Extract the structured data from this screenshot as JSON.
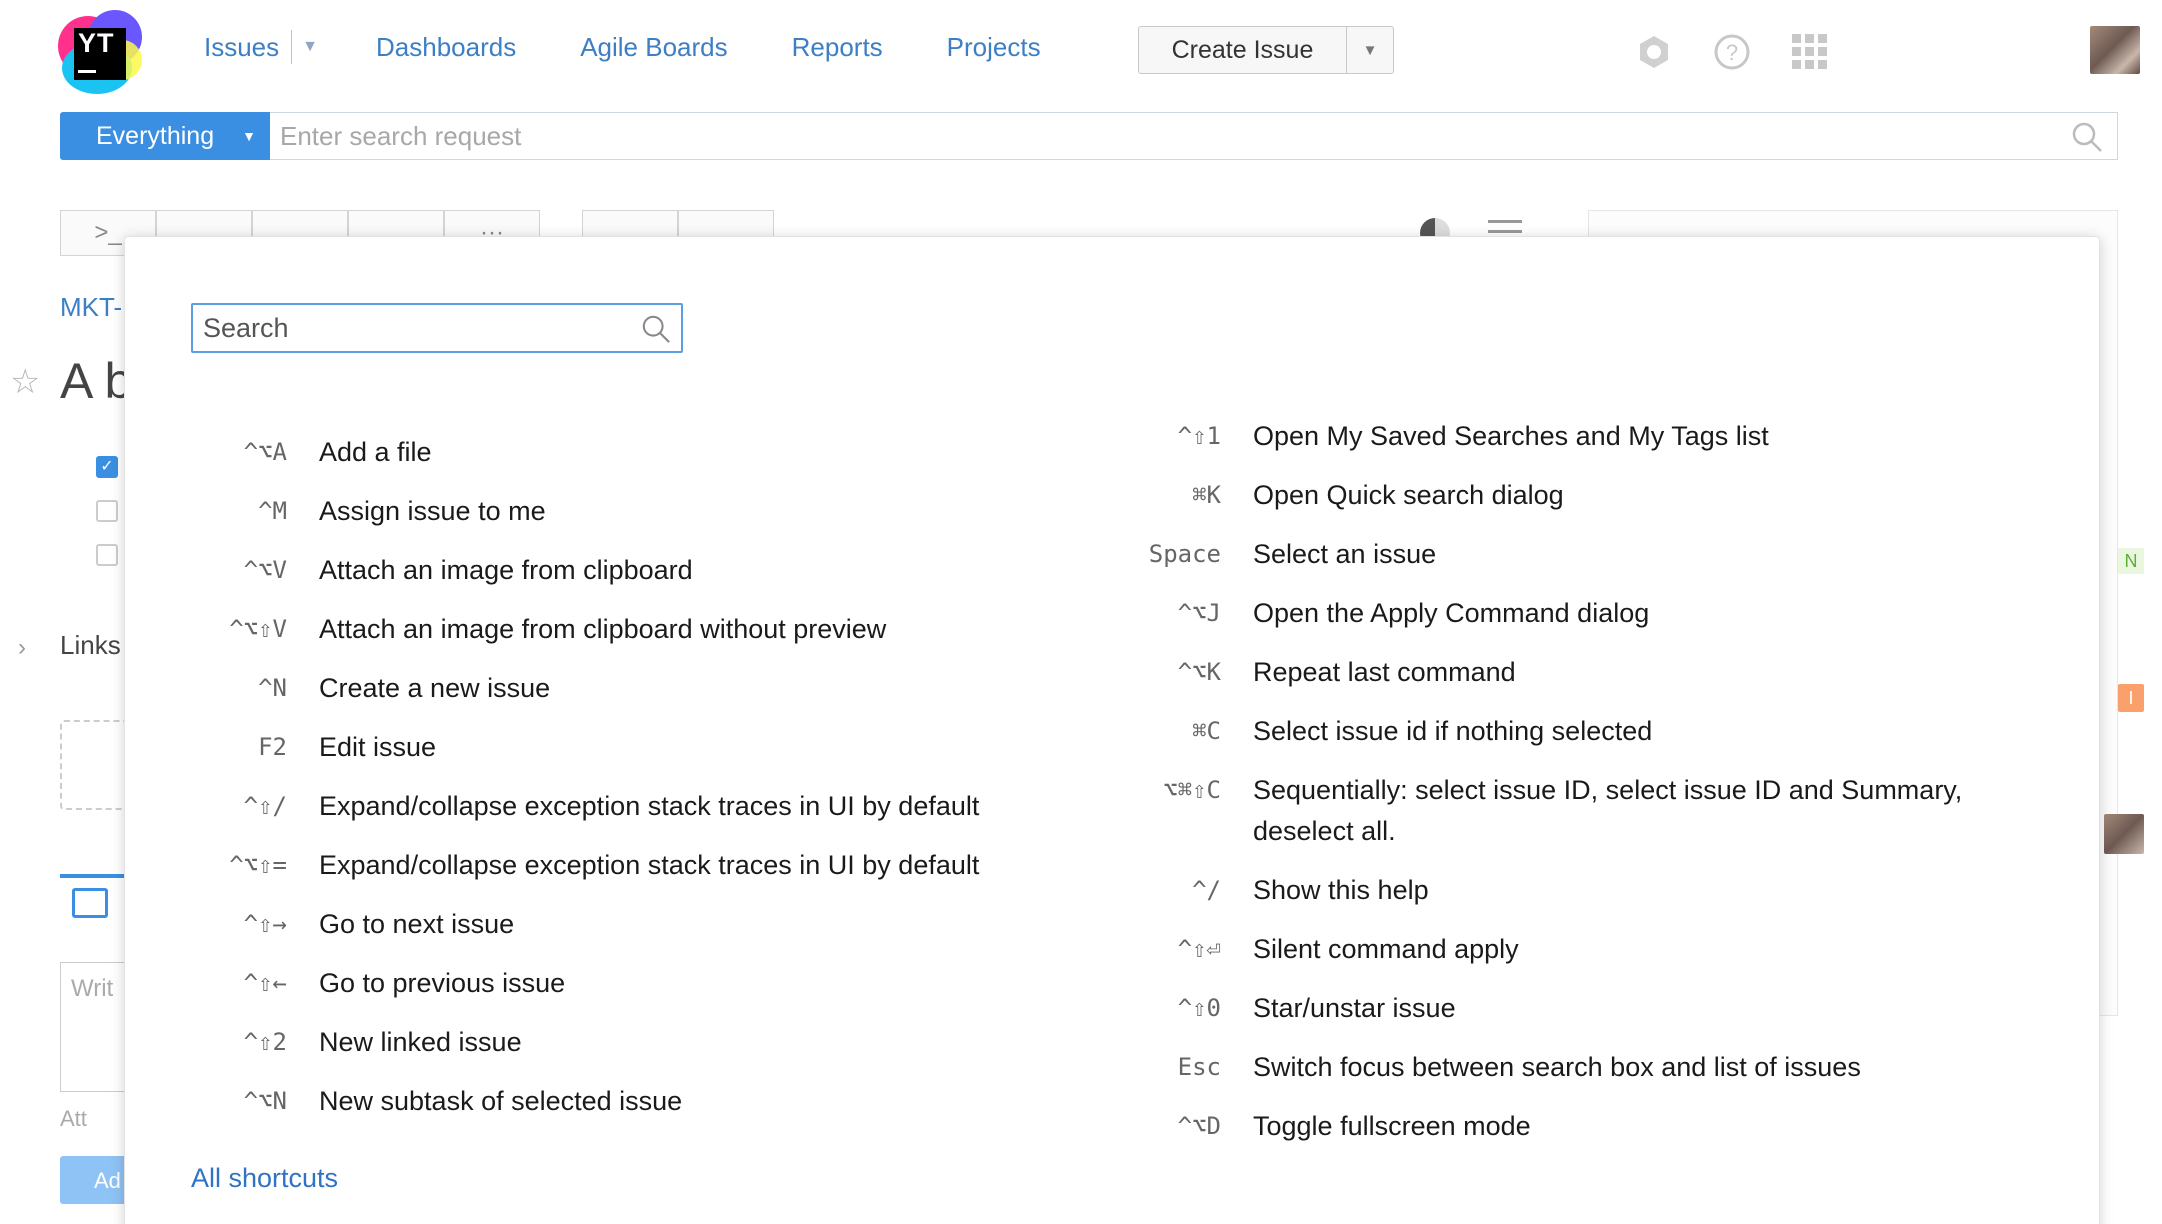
{
  "app": {
    "logo_text": "YT"
  },
  "nav": {
    "issues": "Issues",
    "dashboards": "Dashboards",
    "agile_boards": "Agile Boards",
    "reports": "Reports",
    "projects": "Projects",
    "create_issue": "Create Issue"
  },
  "header_icons": [
    "hub-icon",
    "help-icon",
    "apps-grid-icon"
  ],
  "search": {
    "context": "Everything",
    "placeholder": "Enter search request"
  },
  "background": {
    "issue_id": "MKT-",
    "issue_title": "A b",
    "links_label": "Links",
    "write_placeholder": "Writ",
    "attach_label": "Att",
    "add_button": "Ad",
    "tag_n": "N",
    "tag_i": "I"
  },
  "shortcuts_modal": {
    "search_placeholder": "Search",
    "left_column": [
      {
        "keys": "^⌥A",
        "desc": "Add a file"
      },
      {
        "keys": "^M",
        "desc": "Assign issue to me"
      },
      {
        "keys": "^⌥V",
        "desc": "Attach an image from clipboard"
      },
      {
        "keys": "^⌥⇧V",
        "desc": "Attach an image from clipboard without preview"
      },
      {
        "keys": "^N",
        "desc": "Create a new issue"
      },
      {
        "keys": "F2",
        "desc": "Edit issue"
      },
      {
        "keys": "^⇧/",
        "desc": "Expand/collapse exception stack traces in UI by default"
      },
      {
        "keys": "^⌥⇧=",
        "desc": "Expand/collapse exception stack traces in UI by default"
      },
      {
        "keys": "^⇧→",
        "desc": "Go to next issue"
      },
      {
        "keys": "^⇧←",
        "desc": "Go to previous issue"
      },
      {
        "keys": "^⇧2",
        "desc": "New linked issue"
      },
      {
        "keys": "^⌥N",
        "desc": "New subtask of selected issue"
      }
    ],
    "right_column": [
      {
        "keys": "^⇧1",
        "desc": "Open My Saved Searches and My Tags list"
      },
      {
        "keys": "⌘K",
        "desc": "Open Quick search dialog"
      },
      {
        "keys": "Space",
        "desc": "Select an issue"
      },
      {
        "keys": "^⌥J",
        "desc": "Open the Apply Command dialog"
      },
      {
        "keys": "^⌥K",
        "desc": "Repeat last command"
      },
      {
        "keys": "⌘C",
        "desc": "Select issue id if nothing selected"
      },
      {
        "keys": "⌥⌘⇧C",
        "desc": "Sequentially: select issue ID, select issue ID and Summary, deselect all."
      },
      {
        "keys": "^/",
        "desc": "Show this help"
      },
      {
        "keys": "^⇧⏎",
        "desc": "Silent command apply"
      },
      {
        "keys": "^⇧0",
        "desc": "Star/unstar issue"
      },
      {
        "keys": "Esc",
        "desc": "Switch focus between search box and list of issues"
      },
      {
        "keys": "^⌥D",
        "desc": "Toggle fullscreen mode"
      }
    ],
    "all_shortcuts_link": "All shortcuts"
  },
  "colors": {
    "accent": "#3b8fe2",
    "link": "#3d7fc4"
  }
}
